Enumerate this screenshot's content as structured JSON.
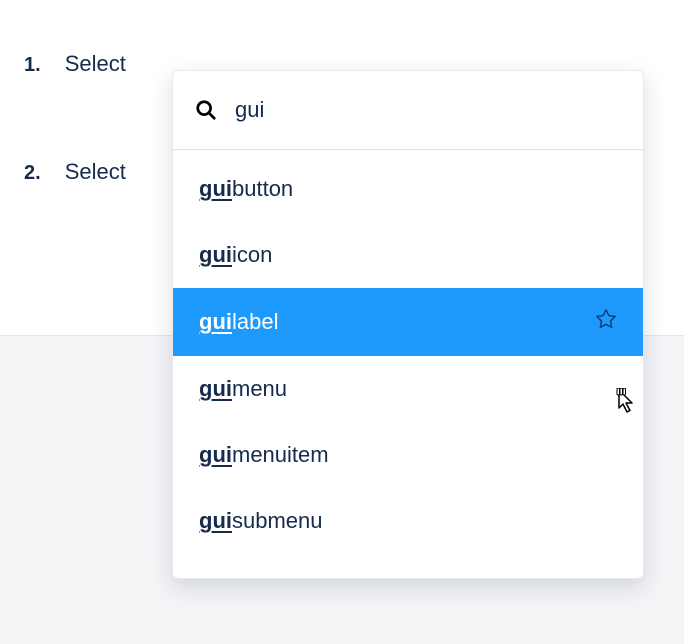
{
  "list": {
    "items": [
      {
        "num": "1.",
        "text": "Select"
      },
      {
        "num": "2.",
        "text": "Select"
      }
    ]
  },
  "dropdown": {
    "search_value": "gui",
    "results": [
      {
        "match": "gui",
        "rest": "button",
        "selected": false,
        "starred": false
      },
      {
        "match": "gui",
        "rest": "icon",
        "selected": false,
        "starred": false
      },
      {
        "match": "gui",
        "rest": "label",
        "selected": true,
        "starred": true
      },
      {
        "match": "gui",
        "rest": "menu",
        "selected": false,
        "starred": false
      },
      {
        "match": "gui",
        "rest": "menuitem",
        "selected": false,
        "starred": false
      },
      {
        "match": "gui",
        "rest": "submenu",
        "selected": false,
        "starred": false
      }
    ]
  }
}
